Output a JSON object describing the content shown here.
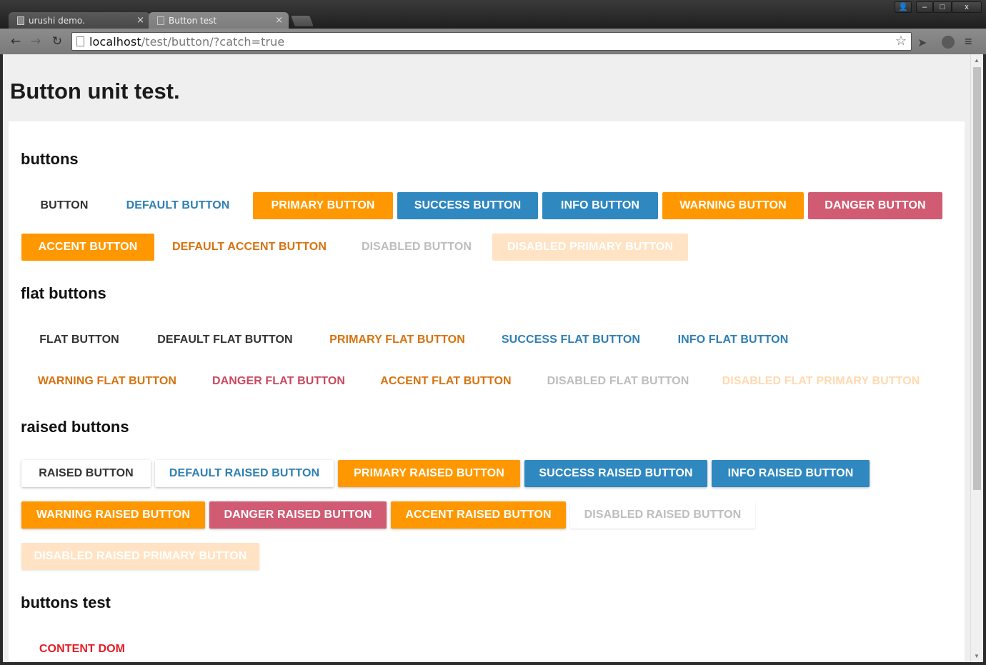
{
  "browser": {
    "tabs": [
      {
        "label": "urushi demo.",
        "close": "×"
      },
      {
        "label": "Button test",
        "close": "×"
      }
    ],
    "window_controls": {
      "user": "👤",
      "minimize": "–",
      "maximize": "□",
      "close": "x"
    },
    "nav": {
      "back": "←",
      "forward": "→",
      "reload": "↻"
    },
    "address": {
      "host": "localhost",
      "path": "/test/button/?catch=true"
    },
    "star": "☆",
    "menu": "≡"
  },
  "page": {
    "title": "Button unit test.",
    "sections": {
      "buttons": {
        "title": "buttons",
        "row1": [
          "Button",
          "Default Button",
          "Primary Button",
          "Success Button",
          "Info Button",
          "Warning Button",
          "Danger Button"
        ],
        "row2": [
          "Accent Button",
          "Default Accent Button",
          "Disabled Button",
          "Disabled Primary Button"
        ]
      },
      "flat": {
        "title": "flat buttons",
        "row1": [
          "Flat Button",
          "Default Flat Button",
          "Primary Flat Button",
          "Success Flat Button",
          "Info Flat Button"
        ],
        "row2": [
          "Warning Flat Button",
          "Danger Flat Button",
          "Accent Flat Button",
          "Disabled Flat Button",
          "Disabled Flat Primary Button"
        ]
      },
      "raised": {
        "title": "raised buttons",
        "row1": [
          "Raised Button",
          "Default Raised Button",
          "Primary Raised Button",
          "Success Raised Button",
          "Info Raised Button"
        ],
        "row2": [
          "Warning Raised Button",
          "Danger Raised Button",
          "Accent Raised Button",
          "Disabled Raised Button"
        ],
        "row3": [
          "Disabled Raised Primary Button"
        ]
      },
      "test": {
        "title": "buttons test",
        "content": "Content DOM"
      }
    }
  },
  "colors": {
    "orange": "#ff9800",
    "blue": "#2f88c0",
    "red": "#d05b73",
    "content_red": "#e51c23"
  }
}
